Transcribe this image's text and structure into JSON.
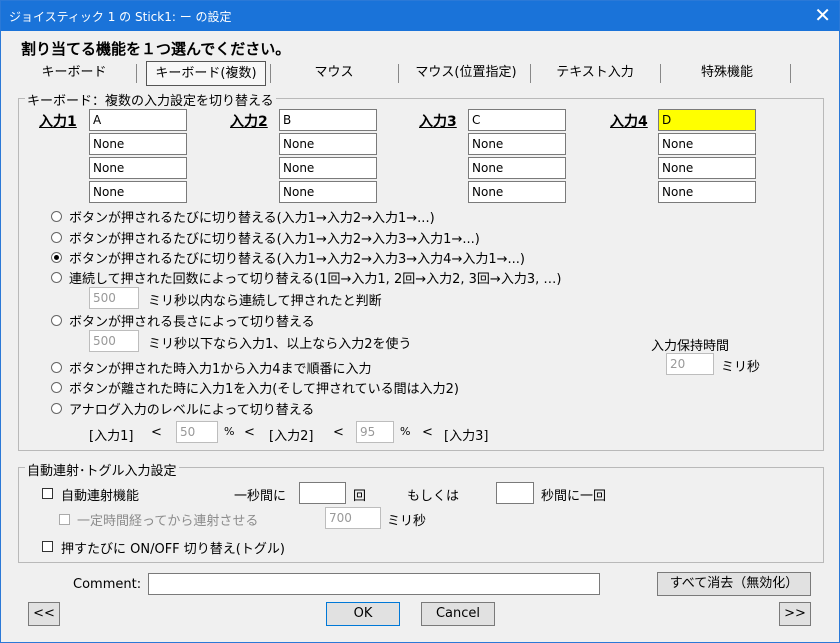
{
  "window": {
    "title": "ジョイスティック 1 の Stick1: ー の設定",
    "close_glyph": "✕"
  },
  "heading": "割り当てる機能を１つ選んでください。",
  "tabs": [
    {
      "label": "キーボード"
    },
    {
      "label": "キーボード(複数)"
    },
    {
      "label": "マウス"
    },
    {
      "label": "マウス(位置指定)"
    },
    {
      "label": "テキスト入力"
    },
    {
      "label": "特殊機能"
    }
  ],
  "keyboard_group": {
    "title": "キーボード：複数の入力設定を切り替える",
    "inputs": [
      {
        "label": "入力1",
        "values": [
          "A",
          "None",
          "None",
          "None"
        ]
      },
      {
        "label": "入力2",
        "values": [
          "B",
          "None",
          "None",
          "None"
        ]
      },
      {
        "label": "入力3",
        "values": [
          "C",
          "None",
          "None",
          "None"
        ]
      },
      {
        "label": "入力4",
        "values": [
          "D",
          "None",
          "None",
          "None"
        ]
      }
    ],
    "options": [
      {
        "label": "ボタンが押されるたびに切り替える(入力1→入力2→入力1→...)",
        "selected": false
      },
      {
        "label": "ボタンが押されるたびに切り替える(入力1→入力2→入力3→入力1→...)",
        "selected": false
      },
      {
        "label": "ボタンが押されるたびに切り替える(入力1→入力2→入力3→入力4→入力1→...)",
        "selected": true
      },
      {
        "label": "連続して押された回数によって切り替える(1回→入力1, 2回→入力2, 3回→入力3, …)",
        "selected": false
      },
      {
        "label": "ボタンが押される長さによって切り替える",
        "selected": false
      },
      {
        "label": "ボタンが押された時入力1から入力4まで順番に入力",
        "selected": false
      },
      {
        "label": "ボタンが離された時に入力1を入力(そして押されている間は入力2)",
        "selected": false
      },
      {
        "label": "アナログ入力のレベルによって切り替える",
        "selected": false
      }
    ],
    "consecutive_ms": "500",
    "consecutive_label": "ミリ秒以内なら連続して押されたと判断",
    "length_ms": "500",
    "length_label": "ミリ秒以下なら入力1、以上なら入力2を使う",
    "hold_label": "入力保持時間",
    "hold_value": "20",
    "hold_unit": "ミリ秒",
    "analog": {
      "in1": "[入力1]",
      "lt1": "<",
      "val1": "50",
      "pct1": "%",
      "lt2": "<",
      "in2": "[入力2]",
      "lt3": "<",
      "val2": "95",
      "pct2": "%",
      "lt4": "<",
      "in3": "[入力3]"
    }
  },
  "auto_group": {
    "title": "自動連射･トグル入力設定",
    "auto_fire_label": "自動連射機能",
    "per_second_label": "一秒間に",
    "times_value": "",
    "times_unit": "回",
    "or_label": "もしくは",
    "seconds_value": "",
    "seconds_label": "秒間に一回",
    "delay_label": "一定時間経ってから連射させる",
    "delay_value": "700",
    "delay_unit": "ミリ秒",
    "toggle_label": "押すたびに ON/OFF 切り替え(トグル)"
  },
  "comment_label": "Comment:",
  "comment_value": "",
  "clear_button": "すべて消去（無効化）",
  "prev_button": "<<",
  "ok_button": "OK",
  "cancel_button": "Cancel",
  "next_button": ">>"
}
